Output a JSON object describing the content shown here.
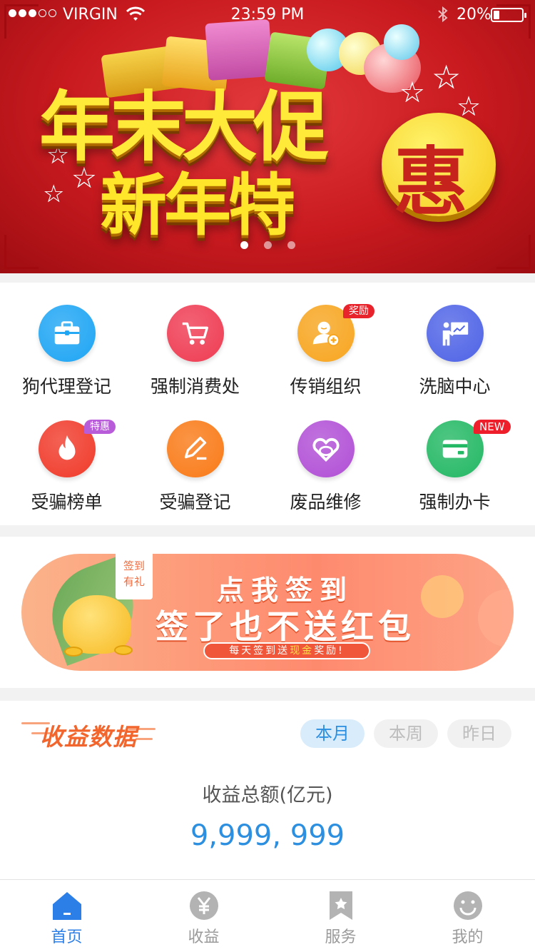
{
  "status_bar": {
    "carrier": "VIRGIN",
    "time": "23:59 PM",
    "battery": "20%",
    "battery_level": 0.2
  },
  "banner": {
    "line1": "年末大促",
    "line2": "新年特",
    "highlight": "惠",
    "slide_count": 3,
    "active_slide": 1
  },
  "services": [
    {
      "label": "狗代理登记",
      "icon": "briefcase-icon",
      "color": "#1ea5f4",
      "badge": ""
    },
    {
      "label": "强制消费处",
      "icon": "cart-icon",
      "color": "#ef3b52",
      "badge": ""
    },
    {
      "label": "传销组织",
      "icon": "add-user-icon",
      "color": "#f7a51f",
      "badge": "奖励"
    },
    {
      "label": "洗脑中心",
      "icon": "presentation-icon",
      "color": "#4f63e6",
      "badge": ""
    },
    {
      "label": "受骗榜单",
      "icon": "flame-icon",
      "color": "#f03a2a",
      "badge": "特惠"
    },
    {
      "label": "受骗登记",
      "icon": "pen-icon",
      "color": "#f97a17",
      "badge": ""
    },
    {
      "label": "废品维修",
      "icon": "heart-knot-icon",
      "color": "#b14fd6",
      "badge": ""
    },
    {
      "label": "强制办卡",
      "icon": "card-icon",
      "color": "#23b864",
      "badge": "NEW"
    }
  ],
  "sign_banner": {
    "tag_line1": "签到",
    "tag_line2": "有礼",
    "title": "点我签到",
    "subtitle": "签了也不送红包",
    "note_pre": "每天签到送",
    "note_cash": "现金",
    "note_post": "奖励!"
  },
  "earnings": {
    "title": "收益数据",
    "tabs": [
      {
        "label": "本月",
        "active": true
      },
      {
        "label": "本周",
        "active": false
      },
      {
        "label": "昨日",
        "active": false
      }
    ],
    "total_label": "收益总额(亿元)",
    "total_value": "9,999, 999"
  },
  "tabbar": [
    {
      "label": "首页",
      "icon": "home-icon",
      "active": true
    },
    {
      "label": "收益",
      "icon": "yuan-icon",
      "active": false
    },
    {
      "label": "服务",
      "icon": "bookmark-star-icon",
      "active": false
    },
    {
      "label": "我的",
      "icon": "smiley-icon",
      "active": false
    }
  ],
  "colors": {
    "accent_blue": "#2d8fe0",
    "tab_active": "#2d7fe8",
    "earn_orange": "#f2662e",
    "banner_red": "#c81a1f"
  }
}
